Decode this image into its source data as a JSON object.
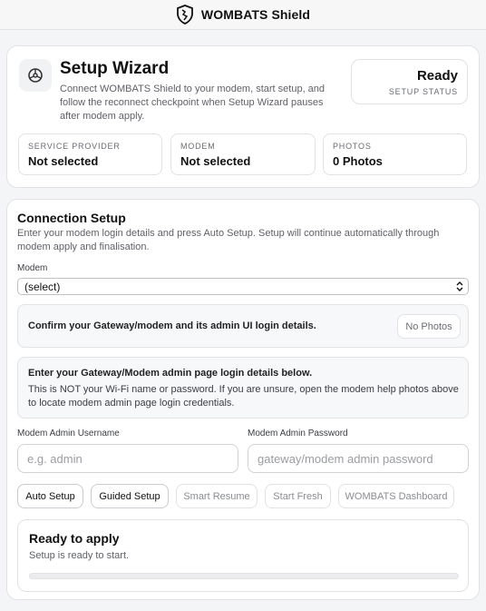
{
  "app": {
    "title": "WOMBATS Shield"
  },
  "header": {
    "title": "Setup Wizard",
    "description": "Connect WOMBATS Shield to your modem, start setup, and follow the reconnect checkpoint when Setup Wizard pauses after modem apply.",
    "status": {
      "value": "Ready",
      "label": "SETUP STATUS"
    },
    "stats": [
      {
        "label": "SERVICE PROVIDER",
        "value": "Not selected"
      },
      {
        "label": "MODEM",
        "value": "Not selected"
      },
      {
        "label": "PHOTOS",
        "value": "0 Photos"
      }
    ]
  },
  "connection": {
    "title": "Connection Setup",
    "subtitle": "Enter your modem login details and press Auto Setup. Setup will continue automatically through modem apply and finalisation.",
    "modem_label": "Modem",
    "modem_selected": "(select)",
    "confirm_text": "Confirm your Gateway/modem and its admin UI login details.",
    "no_photos_label": "No Photos",
    "info_title": "Enter your Gateway/Modem admin page login details below.",
    "info_body": "This is NOT your Wi-Fi name or password. If you are unsure, open the modem help photos above to locate modem admin page login credentials.",
    "username_label": "Modem Admin Username",
    "username_placeholder": "e.g. admin",
    "password_label": "Modem Admin Password",
    "password_placeholder": "gateway/modem admin password",
    "buttons": {
      "auto_setup": "Auto Setup",
      "guided_setup": "Guided Setup",
      "smart_resume": "Smart Resume",
      "start_fresh": "Start Fresh",
      "dashboard": "WOMBATS Dashboard"
    },
    "ready": {
      "title": "Ready to apply",
      "subtitle": "Setup is ready to start.",
      "progress": 0
    }
  },
  "icons": {
    "app_logo": "shield-icon",
    "wizard": "steering-wheel-icon",
    "select_chevron": "chevron-updown-icon"
  }
}
